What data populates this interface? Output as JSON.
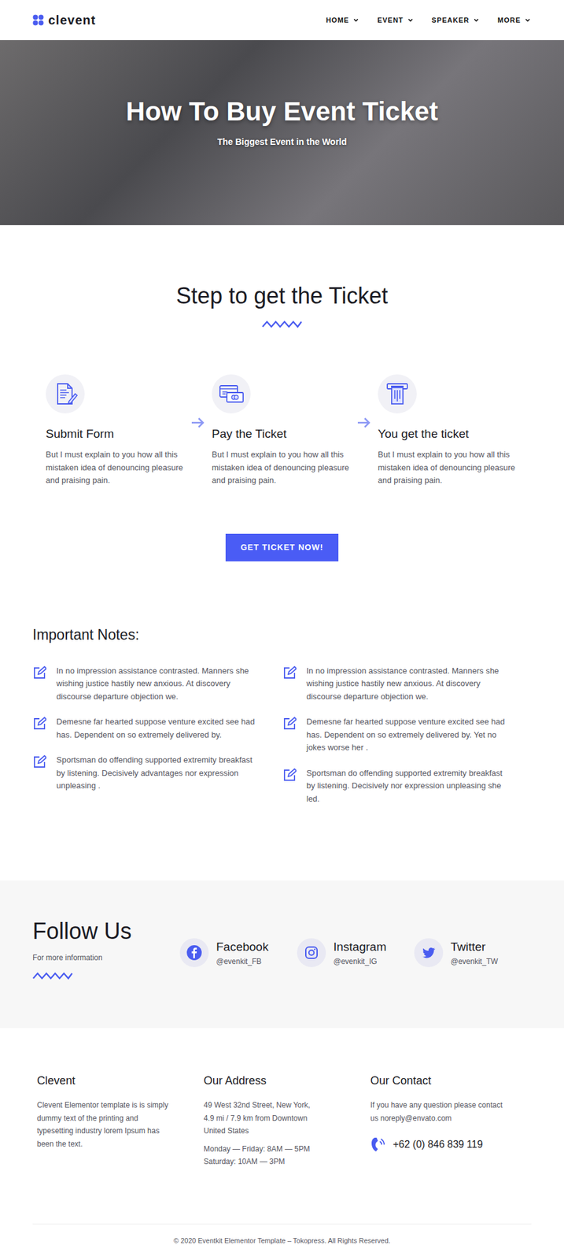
{
  "header": {
    "logo": "clevent",
    "nav": [
      {
        "label": "HOME"
      },
      {
        "label": "EVENT"
      },
      {
        "label": "SPEAKER"
      },
      {
        "label": "MORE"
      }
    ]
  },
  "hero": {
    "title": "How To Buy Event Ticket",
    "subtitle": "The Biggest Event in the World"
  },
  "steps": {
    "title": "Step to get the Ticket",
    "items": [
      {
        "title": "Submit Form",
        "text": "But I must explain to you how all this mistaken idea of denouncing pleasure and praising pain."
      },
      {
        "title": "Pay the Ticket",
        "text": "But I must explain to you how all this mistaken idea of denouncing pleasure and praising pain."
      },
      {
        "title": "You get the ticket",
        "text": "But I must explain to you how all this mistaken idea of denouncing pleasure and praising pain."
      }
    ]
  },
  "cta": "GET TICKET NOW!",
  "notes": {
    "title": "Important Notes:",
    "columns": [
      [
        "In no impression assistance contrasted. Manners she wishing justice hastily new anxious. At discovery discourse departure objection we.",
        "Demesne far hearted suppose venture excited see had has. Dependent on so extremely delivered by.",
        "Sportsman do offending supported extremity breakfast by listening. Decisively advantages nor expression unpleasing ."
      ],
      [
        "In no impression assistance contrasted. Manners she wishing justice hastily new anxious. At discovery discourse departure objection we.",
        "Demesne far hearted suppose venture excited see had has. Dependent on so extremely delivered by. Yet no jokes worse her .",
        "Sportsman do offending supported extremity breakfast by listening. Decisively nor expression unpleasing she led."
      ]
    ]
  },
  "follow": {
    "title": "Follow Us",
    "subtitle": "For more information",
    "socials": [
      {
        "name": "Facebook",
        "handle": "@evenkit_FB"
      },
      {
        "name": "Instagram",
        "handle": "@evenkit_IG"
      },
      {
        "name": "Twitter",
        "handle": "@evenkit_TW"
      }
    ]
  },
  "footer": {
    "about": {
      "title": "Clevent",
      "text": "Clevent Elementor template is is simply dummy text of the printing and typesetting industry lorem Ipsum has been the text."
    },
    "address": {
      "title": "Our Address",
      "text": "49 West 32nd Street, New York, 4.9 mi / 7.9 km from Downtown United States",
      "hours": [
        "Monday — Friday: 8AM — 5PM",
        "Saturday: 10AM — 3PM"
      ]
    },
    "contact": {
      "title": "Our Contact",
      "text": "If you have any question please contact us noreply@envato.com",
      "phone": "+62 (0) 846 839 119"
    }
  },
  "copyright": "© 2020 Eventkit Elementor Template – Tokopress. All Rights Reserved."
}
